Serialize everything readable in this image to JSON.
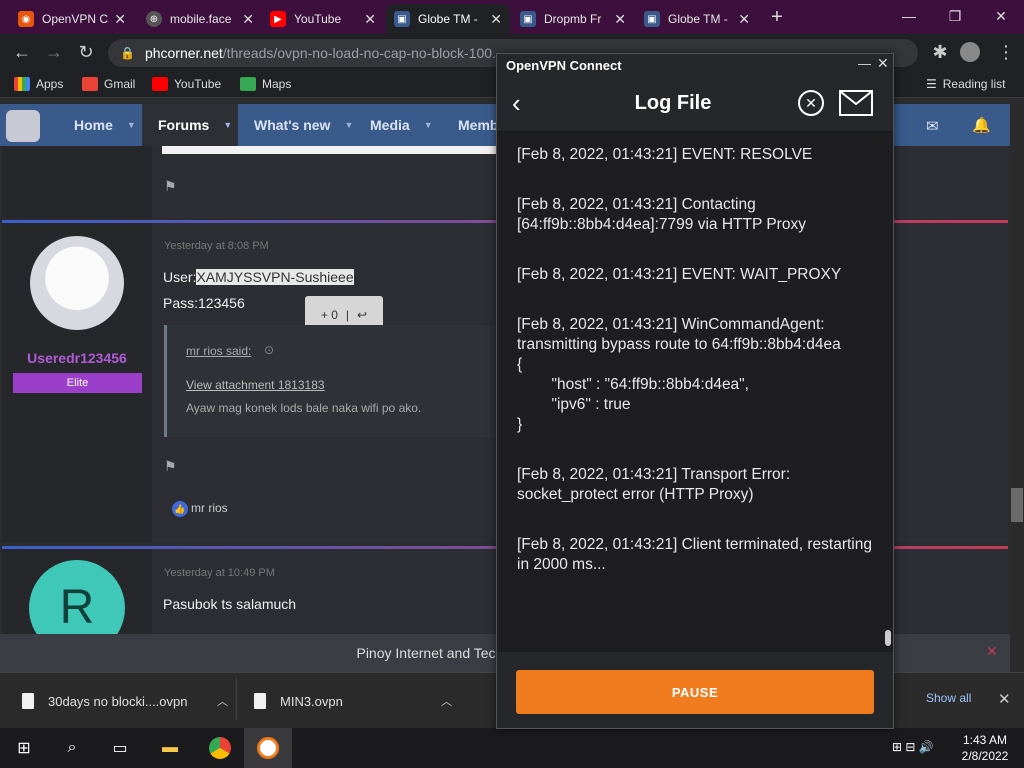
{
  "browser": {
    "tabs": [
      {
        "title": "OpenVPN C",
        "icon": "openvpn-icon",
        "color": "#e8560e"
      },
      {
        "title": "mobile.face",
        "icon": "globe-icon",
        "color": "#555"
      },
      {
        "title": "YouTube",
        "icon": "youtube-icon",
        "color": "#ff0000"
      },
      {
        "title": "Globe TM -",
        "icon": "phcorner-icon",
        "color": "#3a5a8c",
        "active": true
      },
      {
        "title": "Dropmb Fr",
        "icon": "phcorner-icon",
        "color": "#3a5a8c"
      },
      {
        "title": "Globe TM -",
        "icon": "phcorner-icon",
        "color": "#3a5a8c"
      }
    ],
    "new_tab": "+",
    "url_host": "phcorner.net",
    "url_path": "/threads/ovpn-no-load-no-cap-no-block-100..."
  },
  "bookmarks": [
    {
      "label": "Apps",
      "color": "#4285f4"
    },
    {
      "label": "Gmail",
      "color": "#ea4335"
    },
    {
      "label": "YouTube",
      "color": "#ff0000"
    },
    {
      "label": "Maps",
      "color": "#34a853"
    }
  ],
  "reading_list": "Reading list",
  "forum": {
    "nav": [
      {
        "label": "Home"
      },
      {
        "label": "Forums",
        "active": true
      },
      {
        "label": "What's new"
      },
      {
        "label": "Media"
      },
      {
        "label": "Memb"
      }
    ],
    "post1": {
      "time": "Yesterday at 8:08 PM",
      "user_line_prefix": "User:",
      "user_line_value": "XAMJYSSVPN-Sushieee",
      "pass_line": "Pass:123456",
      "username": "Useredr123456",
      "rank": "Elite",
      "quote_author": "mr rios said:",
      "quote_attachment": "View attachment 1813183",
      "quote_text": "Ayaw mag konek lods bale naka wifi po ako.",
      "reaction_count": "+ 0",
      "reaction_user": "mr rios"
    },
    "post2": {
      "time": "Yesterday at 10:49 PM",
      "avatar_letter": "R",
      "text": "Pasubok ts salamuch"
    },
    "cookie_text": "Pinoy Internet and Technology Forums would lik"
  },
  "downloads": [
    {
      "name": "30days no blocki....ovpn"
    },
    {
      "name": "MIN3.ovpn"
    }
  ],
  "show_all": "Show all",
  "taskbar": {
    "time": "1:43 AM",
    "date": "2/8/2022"
  },
  "ovpn": {
    "window_title": "OpenVPN Connect",
    "header_title": "Log File",
    "log_lines": [
      "[Feb 8, 2022, 01:43:21] EVENT: RESOLVE",
      "[Feb 8, 2022, 01:43:21] Contacting [64:ff9b::8bb4:d4ea]:7799 via HTTP Proxy",
      "[Feb 8, 2022, 01:43:21] EVENT: WAIT_PROXY",
      "[Feb 8, 2022, 01:43:21] WinCommandAgent: transmitting bypass route to 64:ff9b::8bb4:d4ea\n{\n        \"host\" : \"64:ff9b::8bb4:d4ea\",\n        \"ipv6\" : true\n}\n",
      "[Feb 8, 2022, 01:43:21] Transport Error: socket_protect error (HTTP Proxy)",
      "[Feb 8, 2022, 01:43:21] Client terminated, restarting in 2000 ms..."
    ],
    "pause_label": "PAUSE",
    "accent": "#f07c1f"
  }
}
